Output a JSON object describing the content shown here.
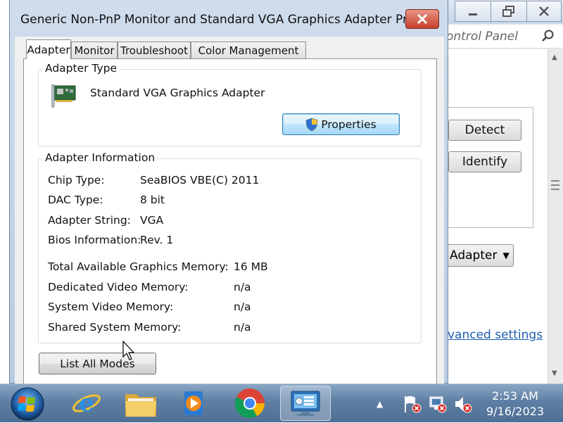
{
  "background_window": {
    "address_text": "ontrol Panel",
    "detect_label": "Detect",
    "identify_label": "Identify",
    "adapter_combo": "Adapter",
    "advanced_link": "vanced settings"
  },
  "dialog": {
    "title": "Generic Non-PnP Monitor and Standard VGA Graphics Adapter Pro...",
    "tabs": [
      {
        "label": "Adapter"
      },
      {
        "label": "Monitor"
      },
      {
        "label": "Troubleshoot"
      },
      {
        "label": "Color Management"
      }
    ],
    "adapter_type": {
      "legend": "Adapter Type",
      "name": "Standard VGA Graphics Adapter",
      "properties_label": "Properties"
    },
    "adapter_info": {
      "legend": "Adapter Information",
      "rows": [
        {
          "label": "Chip Type:",
          "value": "SeaBIOS VBE(C) 2011"
        },
        {
          "label": "DAC Type:",
          "value": "8 bit"
        },
        {
          "label": "Adapter String:",
          "value": "VGA"
        },
        {
          "label": "Bios Information:",
          "value": "Rev. 1"
        }
      ],
      "memory": [
        {
          "label": "Total Available Graphics Memory:",
          "value": "16 MB"
        },
        {
          "label": "Dedicated Video Memory:",
          "value": "n/a"
        },
        {
          "label": "System Video Memory:",
          "value": "n/a"
        },
        {
          "label": "Shared System Memory:",
          "value": "n/a"
        }
      ]
    },
    "list_modes_label": "List All Modes"
  },
  "taskbar": {
    "time": "2:53 AM",
    "date": "9/16/2023"
  }
}
